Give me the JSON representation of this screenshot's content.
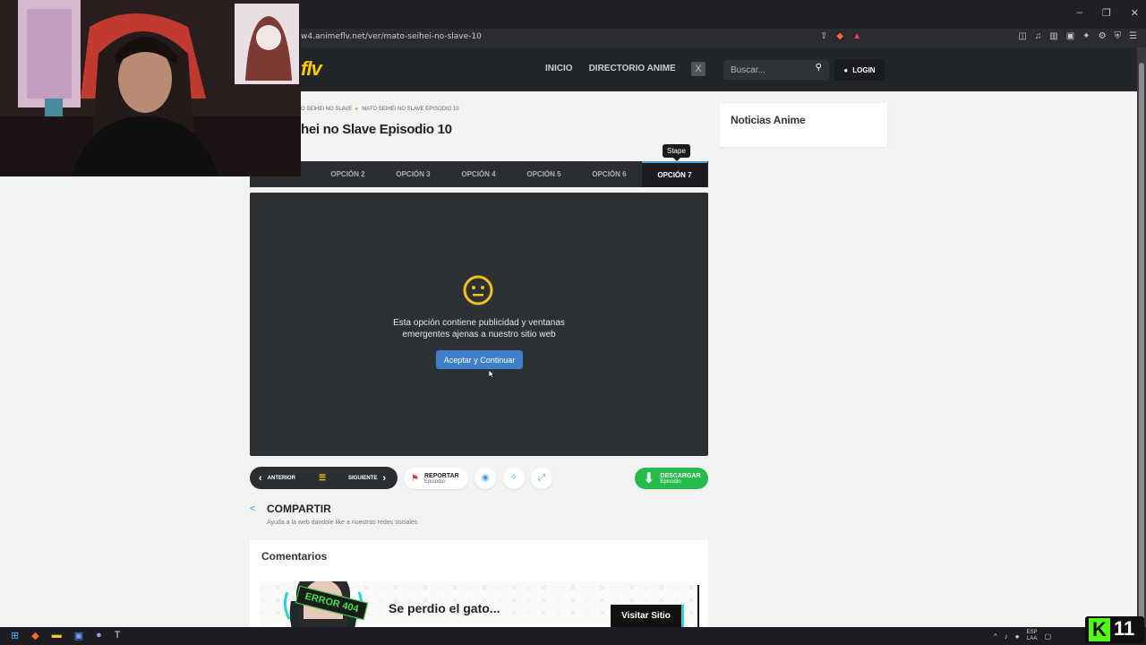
{
  "browser": {
    "url": "w4.animeflv.net/ver/mato-seihei-no-slave-10",
    "window_controls": [
      "–",
      "❐",
      "✕"
    ],
    "ext_icons": [
      "◫",
      "♫",
      "▥",
      "▣",
      "✦",
      "⚙",
      "⛨",
      "☰"
    ]
  },
  "site": {
    "logo": "flv",
    "nav": [
      "INICIO",
      "DIRECTORIO ANIME"
    ],
    "x_label": "X",
    "search_placeholder": "Buscar...",
    "login": "LOGIN"
  },
  "page": {
    "breadcrumb": [
      "O SEIHEI NO SLAVE",
      "MATO SEIHEI NO SLAVE EPISODIO 10"
    ],
    "title": "hei no Slave Episodio 10",
    "tooltip": "Stape",
    "tabs": [
      "OPCIÓN 2",
      "OPCIÓN 3",
      "OPCIÓN 4",
      "OPCIÓN 5",
      "OPCIÓN 6",
      "OPCIÓN 7"
    ],
    "active_tab": "OPCIÓN 7",
    "player_msg_line1": "Esta opción contiene publicidad y ventanas",
    "player_msg_line2": "emergentes ajenas a nuestro sitio web",
    "accept_button": "Aceptar y Continuar",
    "prev": "ANTERIOR",
    "next": "SIGUIENTE",
    "report_l1": "REPORTAR",
    "report_l2": "Episodio",
    "download_l1": "DESCARGAR",
    "download_l2": "Episodio",
    "share_title": "COMPARTIR",
    "share_sub": "Ayuda a la web dandole like a nuestras redes sociales",
    "comments_title": "Comentarios",
    "error_badge": "ERROR 404",
    "error_text": "Se perdio el gato...",
    "error_button": "Visitar Sitio"
  },
  "sidebar": {
    "news_title": "Noticias Anime"
  },
  "taskbar": {
    "lang_l1": "ESP",
    "lang_l2": "LAA",
    "kick_letter": "K",
    "kick_number": "11"
  },
  "colors": {
    "accent_blue": "#3d7fc9",
    "logo_yellow": "#fecc00",
    "download_green": "#26bc4c",
    "kick_green": "#53fc18"
  }
}
